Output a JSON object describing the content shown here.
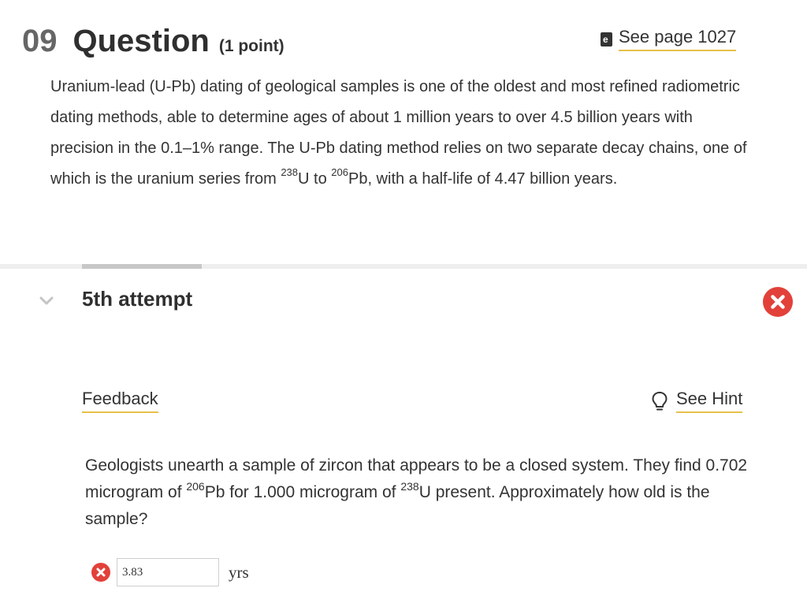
{
  "question": {
    "number": "09",
    "title": "Question",
    "points": "(1 point)",
    "see_page": "See page 1027",
    "ebook_glyph": "e"
  },
  "intro": {
    "part1": "Uranium-lead (U-Pb) dating of geological samples is one of the oldest and most refined radiometric dating methods, able to determine ages of about 1 million years to over 4.5 billion years with precision in the 0.1–1% range. The U-Pb dating method relies on two separate decay chains, one of which is the uranium series from ",
    "sup1": "238",
    "part2": "U to ",
    "sup2": "206",
    "part3": "Pb, with a half-life of 4.47 billion years."
  },
  "attempt": {
    "label": "5th attempt",
    "status": "incorrect"
  },
  "links": {
    "feedback": "Feedback",
    "hint": "See Hint"
  },
  "problem": {
    "part1": "Geologists unearth a sample of zircon that appears to be a closed system. They find 0.702 microgram of ",
    "sup1": "206",
    "part2": "Pb for 1.000 microgram of ",
    "sup2": "238",
    "part3": "U present. Approximately how old is the sample?"
  },
  "answer": {
    "value": "3.83",
    "units": "yrs"
  },
  "icons": {
    "ebook": "ebook-icon",
    "chevron": "chevron-down-icon",
    "error": "error-x-icon",
    "hint": "lightbulb-icon"
  },
  "colors": {
    "error_red": "#e2413a",
    "link_underline": "#e6c04a",
    "divider": "#eeeeee",
    "divider_tab": "#c7c7c7"
  }
}
